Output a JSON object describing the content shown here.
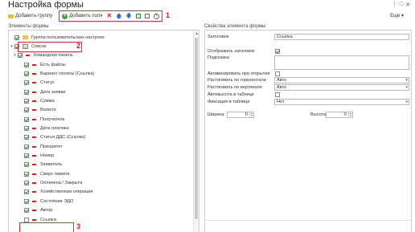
{
  "window": {
    "title": "Настройка формы"
  },
  "toolbar": {
    "add_group": "Добавить группу",
    "add_field": "Добавить поля",
    "more": "Еще",
    "more_arrow": "▾"
  },
  "annotations": [
    "1",
    "2",
    "3"
  ],
  "tree": {
    "label": "Элементы формы",
    "items": [
      {
        "label": "Группа пользовательских настроек",
        "checked": true,
        "icon": "folder-icon",
        "indent": 0
      },
      {
        "label": "Список",
        "checked": true,
        "icon": "list-icon",
        "indent": 0
      },
      {
        "label": "Командная панель",
        "checked": true,
        "icon": "dash-icon",
        "indent": 1
      },
      {
        "label": "Есть файлы",
        "checked": true,
        "icon": "dash-icon",
        "indent": 2
      },
      {
        "label": "Вариант оплаты (Ссылка)",
        "checked": true,
        "icon": "dash-icon",
        "indent": 2
      },
      {
        "label": "Статус",
        "checked": true,
        "icon": "dash-icon",
        "indent": 2
      },
      {
        "label": "Дата заявки",
        "checked": true,
        "icon": "dash-icon",
        "indent": 2
      },
      {
        "label": "Сумма",
        "checked": true,
        "icon": "dash-icon",
        "indent": 2
      },
      {
        "label": "Валюта",
        "checked": true,
        "icon": "dash-icon",
        "indent": 2
      },
      {
        "label": "Получатель",
        "checked": true,
        "icon": "dash-icon",
        "indent": 2
      },
      {
        "label": "Дата платежа",
        "checked": true,
        "icon": "dash-icon",
        "indent": 2
      },
      {
        "label": "Статья ДДС (Ссылка)",
        "checked": true,
        "icon": "dash-icon",
        "indent": 2
      },
      {
        "label": "Приоритет",
        "checked": true,
        "icon": "dash-icon",
        "indent": 2
      },
      {
        "label": "Номер",
        "checked": true,
        "icon": "dash-icon",
        "indent": 2
      },
      {
        "label": "Заявитель",
        "checked": true,
        "icon": "dash-icon",
        "indent": 2
      },
      {
        "label": "Сверх лимита",
        "checked": true,
        "icon": "dash-icon",
        "indent": 2
      },
      {
        "label": "Оплачена / Закрыта",
        "checked": true,
        "icon": "dash-icon",
        "indent": 2
      },
      {
        "label": "Хозяйственная операция",
        "checked": true,
        "icon": "dash-icon",
        "indent": 2
      },
      {
        "label": "Состояние ЭДО",
        "checked": true,
        "icon": "dash-icon",
        "indent": 2
      },
      {
        "label": "Автор",
        "checked": true,
        "icon": "dash-icon",
        "indent": 2
      },
      {
        "label": "Ссылка",
        "checked": false,
        "icon": "dash-icon",
        "indent": 2
      }
    ]
  },
  "props": {
    "label": "Свойства элемента формы",
    "heading_label": "Заголовок",
    "heading_value": "Ссылка",
    "show_heading_label": "Отображать заголовок",
    "show_heading_checked": true,
    "hint_label": "Подсказка",
    "activate_label": "Активизировать при открытии",
    "stretch_h_label": "Растягивать по горизонтали",
    "stretch_h_value": "Авто",
    "stretch_v_label": "Растягивать по вертикали",
    "stretch_v_value": "Авто",
    "autoheight_label": "Автовысота в таблице",
    "fix_label": "Фиксация в таблице",
    "fix_value": "Нет",
    "width_label": "Ширина",
    "width_value": "0",
    "height_label": "Высота",
    "height_value": "0"
  },
  "colors": {
    "annotation": "#d42020",
    "check": "#1f8a1f",
    "add": "#3aa63a",
    "arrow": "#2a6fd4"
  }
}
